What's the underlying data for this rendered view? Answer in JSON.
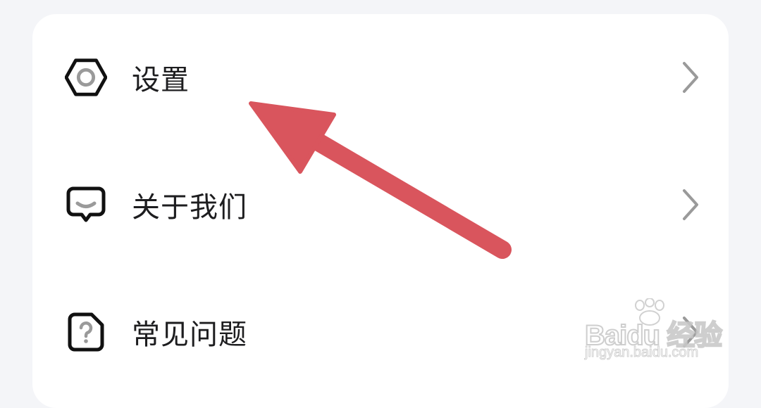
{
  "menu": {
    "items": [
      {
        "label": "设置",
        "icon": "settings-hexagon-icon"
      },
      {
        "label": "关于我们",
        "icon": "chat-bubble-icon"
      },
      {
        "label": "常见问题",
        "icon": "question-document-icon"
      }
    ]
  },
  "annotation": {
    "arrow_color": "#d9555d"
  },
  "watermark": {
    "brand": "Baidu 经验",
    "domain": "jingyan.baidu.com"
  }
}
